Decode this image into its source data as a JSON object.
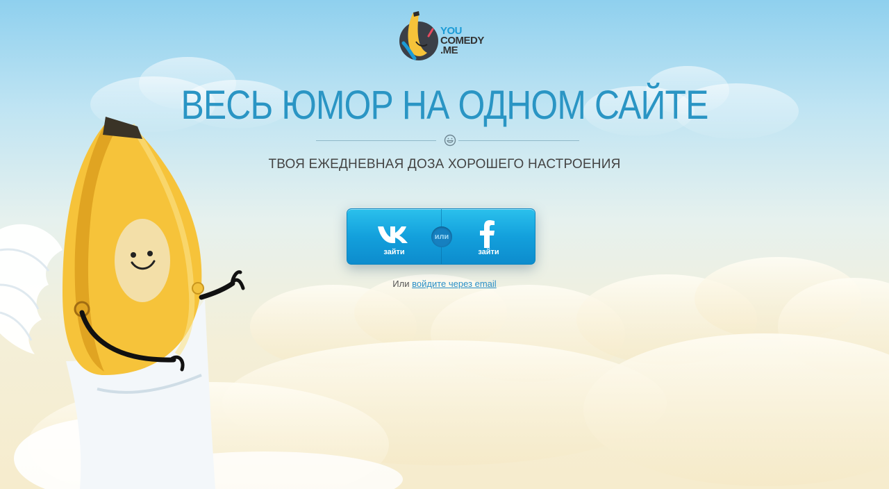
{
  "logo": {
    "line1": "YOU",
    "line2": "COMEDY",
    "line3": ".ME"
  },
  "headline": "ВЕСЬ ЮМОР НА ОДНОМ САЙТЕ",
  "subtitle": "ТВОЯ ЕЖЕДНЕВНАЯ ДОЗА ХОРОШЕГО НАСТРОЕНИЯ",
  "social": {
    "vk_label": "зайти",
    "or_label": "или",
    "fb_label": "зайти"
  },
  "email_login": {
    "prefix": "Или",
    "link": "войдите через email"
  },
  "colors": {
    "brand_blue": "#1b9bd6",
    "headline": "#2a95c4",
    "button": "#13a0dc",
    "banana": "#f6c33a"
  },
  "icons": [
    "banana-logo-icon",
    "smile-icon",
    "vk-icon",
    "facebook-icon"
  ]
}
